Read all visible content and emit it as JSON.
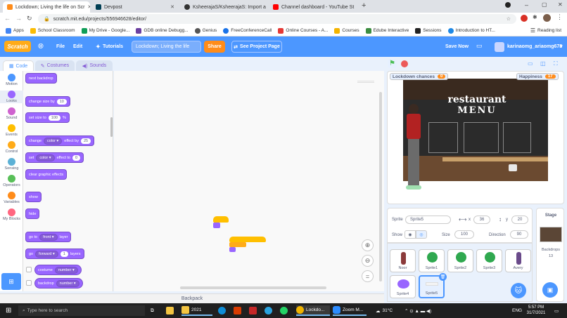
{
  "browser": {
    "tabs": [
      {
        "label": "Lockdown; Living the life on Scr",
        "active": true,
        "color": "#ff8c1a"
      },
      {
        "label": "Devpost",
        "active": false,
        "color": "#003e54"
      },
      {
        "label": "KsheerajaS/KsheerajaS: Import a",
        "active": false,
        "color": "#333333"
      },
      {
        "label": "Channel dashboard - YouTube St",
        "active": false,
        "color": "#ff0000"
      }
    ],
    "url": "scratch.mit.edu/projects/556946628/editor/",
    "bookmarks": [
      "Apps",
      "School Classroom",
      "My Drive - Google...",
      "GDB online Debugg...",
      "Genius",
      "FreeConferenceCall",
      "Online Courses - A...",
      "Courses",
      "Edube Interactive",
      "Sessions",
      "Introduction to HT..."
    ],
    "reading_list": "Reading list"
  },
  "menubar": {
    "logo": "Scratch",
    "file": "File",
    "edit": "Edit",
    "tutorials": "Tutorials",
    "project_title": "Lockdown; Living the life",
    "share": "Share",
    "see_project_page": "See Project Page",
    "save_now": "Save Now",
    "username": "karinaomg_ariaomg678"
  },
  "editor_tabs": {
    "code": "Code",
    "costumes": "Costumes",
    "sounds": "Sounds"
  },
  "categories": [
    {
      "label": "Motion",
      "color": "#4c97ff"
    },
    {
      "label": "Looks",
      "color": "#9966ff"
    },
    {
      "label": "Sound",
      "color": "#cf63cf"
    },
    {
      "label": "Events",
      "color": "#ffbf00"
    },
    {
      "label": "Control",
      "color": "#ffab19"
    },
    {
      "label": "Sensing",
      "color": "#5cb1d6"
    },
    {
      "label": "Operators",
      "color": "#59c059"
    },
    {
      "label": "Variables",
      "color": "#ff8c1a"
    },
    {
      "label": "My Blocks",
      "color": "#ff6680"
    }
  ],
  "blocks": {
    "next_backdrop": "next backdrop",
    "change_size_by": "change size by",
    "change_size_val": "10",
    "set_size_to": "set size to",
    "set_size_val": "100",
    "percent": "%",
    "change": "change",
    "color": "color",
    "effect_by": "effect by",
    "effect_by_val": "25",
    "set": "set",
    "effect_to": "effect to",
    "effect_to_val": "0",
    "clear_graphic_effects": "clear graphic effects",
    "show": "show",
    "hide": "hide",
    "go_to": "go to",
    "front": "front",
    "layer": "layer",
    "go": "go",
    "forward": "forward",
    "layers_val": "1",
    "layers": "layers",
    "costume": "costume",
    "number": "number",
    "backdrop": "backdrop"
  },
  "backpack": "Backpack",
  "stage": {
    "monitors": [
      {
        "label": "Lockdown chances",
        "value": "0"
      },
      {
        "label": "Happiness",
        "value": "17"
      }
    ],
    "menu_title_1": "restaurant",
    "menu_title_2": "MENU"
  },
  "sprite_info": {
    "sprite_label": "Sprite",
    "sprite_name": "Sprite5",
    "x_label": "x",
    "x": "36",
    "y_label": "y",
    "y": "20",
    "show_label": "Show",
    "size_label": "Size",
    "size": "100",
    "direction_label": "Direction",
    "direction": "90"
  },
  "sprites": [
    "Noor",
    "Sprite1",
    "Sprite2",
    "Sprite3",
    "Avery",
    "Sprite4",
    "Sprite5"
  ],
  "stage_panel": {
    "title": "Stage",
    "backdrops_label": "Backdrops",
    "backdrops_count": "13"
  },
  "taskbar": {
    "search": "Type here to search",
    "items": [
      "2021",
      "Lockdo...",
      "Zoom M..."
    ],
    "temp": "31°C",
    "lang": "ENG",
    "time": "5:57 PM",
    "date": "31/7/2021"
  }
}
